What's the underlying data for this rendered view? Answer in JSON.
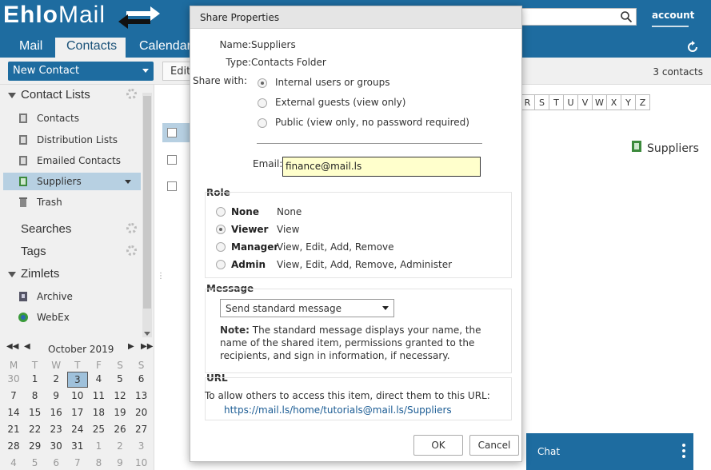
{
  "app": {
    "logo_bold": "Ehlo",
    "logo_light": "Mail",
    "account": "account",
    "tabs": [
      "Mail",
      "Contacts",
      "Calendar"
    ],
    "active_tab": "Contacts"
  },
  "toolbar": {
    "new_contact": "New Contact",
    "edit": "Edit",
    "count": "3 contacts"
  },
  "sidebar": {
    "contact_lists": "Contact Lists",
    "items": [
      "Contacts",
      "Distribution Lists",
      "Emailed Contacts",
      "Suppliers",
      "Trash"
    ],
    "searches": "Searches",
    "tags": "Tags",
    "zimlets": "Zimlets",
    "zimlet_items": [
      "Archive",
      "WebEx"
    ]
  },
  "calendar": {
    "title": "October 2019",
    "weekdays": [
      "M",
      "T",
      "W",
      "T",
      "F",
      "S",
      "S"
    ],
    "weeks": [
      [
        "30",
        "1",
        "2",
        "3",
        "4",
        "5",
        "6"
      ],
      [
        "7",
        "8",
        "9",
        "10",
        "11",
        "12",
        "13"
      ],
      [
        "14",
        "15",
        "16",
        "17",
        "18",
        "19",
        "20"
      ],
      [
        "21",
        "22",
        "23",
        "24",
        "25",
        "26",
        "27"
      ],
      [
        "28",
        "29",
        "30",
        "31",
        "1",
        "2",
        "3"
      ],
      [
        "4",
        "5",
        "6",
        "7",
        "8",
        "9",
        "10"
      ]
    ],
    "today": "3"
  },
  "alphabet": [
    "R",
    "S",
    "T",
    "U",
    "V",
    "W",
    "X",
    "Y",
    "Z"
  ],
  "reading_pane": {
    "name": "Suppliers"
  },
  "chat": {
    "label": "Chat"
  },
  "dialog": {
    "title": "Share Properties",
    "name_label": "Name:",
    "name_value": "Suppliers",
    "type_label": "Type:",
    "type_value": "Contacts Folder",
    "share_with_label": "Share with:",
    "share_options": [
      "Internal users or groups",
      "External guests (view only)",
      "Public (view only, no password required)"
    ],
    "share_selected": 0,
    "email_label": "Email:",
    "email_value": "finance@mail.ls",
    "role_legend": "Role",
    "roles": [
      {
        "name": "None",
        "desc": "None"
      },
      {
        "name": "Viewer",
        "desc": "View"
      },
      {
        "name": "Manager",
        "desc": "View, Edit, Add, Remove"
      },
      {
        "name": "Admin",
        "desc": "View, Edit, Add, Remove, Administer"
      }
    ],
    "role_selected": 1,
    "message_legend": "Message",
    "message_select": "Send standard message",
    "note_bold": "Note:",
    "note_text": " The standard message displays your name, the name of the shared item, permissions granted to the recipients, and sign in information, if necessary.",
    "url_legend": "URL",
    "url_text": "To allow others to access this item, direct them to this URL:",
    "url_link": "https://mail.ls/home/tutorials@mail.ls/Suppliers",
    "ok": "OK",
    "cancel": "Cancel"
  }
}
